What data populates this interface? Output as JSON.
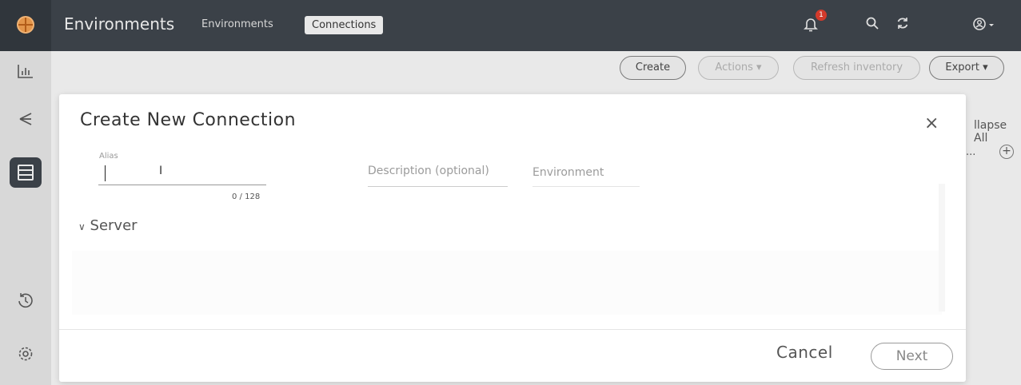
{
  "header": {
    "app_title": "Environments",
    "nav": [
      {
        "label": "Environments",
        "active": false
      },
      {
        "label": "Connections",
        "active": true
      }
    ],
    "notifications_count": "1",
    "icons": [
      "search-icon",
      "refresh-icon",
      "bell-icon",
      "user-icon"
    ]
  },
  "sidebar": {
    "items": [
      "chart-icon",
      "topology-icon",
      "table-icon",
      "history-icon",
      "settings-icon"
    ],
    "active": "table-icon"
  },
  "toolbar": {
    "create_label": "Create",
    "actions_label": "Actions ▾",
    "refresh_label": "Refresh inventory",
    "export_label": "Export ▾"
  },
  "background": {
    "collapse_label": "llapse All",
    "dots": "..."
  },
  "modal": {
    "title": "Create New Connection",
    "close_glyph": "×",
    "alias": {
      "label": "Alias",
      "value": "",
      "counter": "0 / 128"
    },
    "description": {
      "placeholder": "Description (optional)"
    },
    "environment": {
      "placeholder": "Environment"
    },
    "section": {
      "label": "Server",
      "expanded": true
    },
    "cancel_label": "Cancel",
    "next_label": "Next"
  },
  "colors": {
    "header_bg": "#3b4148",
    "sidebar_bg": "#d8d8d8",
    "badge": "#d33a2b",
    "logo": "#e2954a"
  }
}
